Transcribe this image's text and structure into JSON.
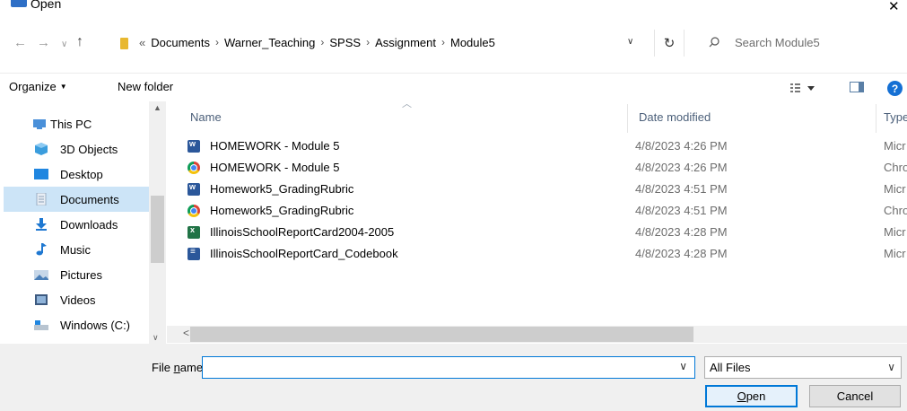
{
  "window": {
    "title": "Open",
    "close_glyph": "✕"
  },
  "address": {
    "leading": "«",
    "crumbs": [
      "Documents",
      "Warner_Teaching",
      "SPSS",
      "Assignment",
      "Module5"
    ],
    "search_placeholder": "Search Module5"
  },
  "toolbar": {
    "organize_label": "Organize",
    "new_folder_label": "New folder",
    "help_glyph": "?"
  },
  "nav": {
    "items": [
      {
        "label": "This PC",
        "icon": "this-pc-icon"
      },
      {
        "label": "3D Objects",
        "icon": "3d-objects-icon"
      },
      {
        "label": "Desktop",
        "icon": "desktop-icon"
      },
      {
        "label": "Documents",
        "icon": "documents-icon",
        "selected": true
      },
      {
        "label": "Downloads",
        "icon": "downloads-icon"
      },
      {
        "label": "Music",
        "icon": "music-icon"
      },
      {
        "label": "Pictures",
        "icon": "pictures-icon"
      },
      {
        "label": "Videos",
        "icon": "videos-icon"
      },
      {
        "label": "Windows (C:)",
        "icon": "drive-icon"
      }
    ]
  },
  "files": {
    "columns": {
      "name": "Name",
      "date": "Date modified",
      "type": "Type"
    },
    "rows": [
      {
        "name": "HOMEWORK - Module 5",
        "date": "4/8/2023 4:26 PM",
        "type": "Micr",
        "icon": "word-doc-icon"
      },
      {
        "name": "HOMEWORK - Module 5",
        "date": "4/8/2023 4:26 PM",
        "type": "Chro",
        "icon": "chrome-doc-icon"
      },
      {
        "name": "Homework5_GradingRubric",
        "date": "4/8/2023 4:51 PM",
        "type": "Micr",
        "icon": "word-doc-icon"
      },
      {
        "name": "Homework5_GradingRubric",
        "date": "4/8/2023 4:51 PM",
        "type": "Chro",
        "icon": "chrome-doc-icon"
      },
      {
        "name": "IllinoisSchoolReportCard2004-2005",
        "date": "4/8/2023 4:28 PM",
        "type": "Micr",
        "icon": "excel-doc-icon"
      },
      {
        "name": "IllinoisSchoolReportCard_Codebook",
        "date": "4/8/2023 4:28 PM",
        "type": "Micr",
        "icon": "word-doc-icon"
      }
    ]
  },
  "footer": {
    "file_name_label_prefix": "File ",
    "file_name_label_hotkey": "n",
    "file_name_label_suffix": "ame:",
    "file_name_value": "",
    "file_type_value": "All Files",
    "open_hotkey": "O",
    "open_rest": "pen",
    "cancel_label": "Cancel"
  }
}
